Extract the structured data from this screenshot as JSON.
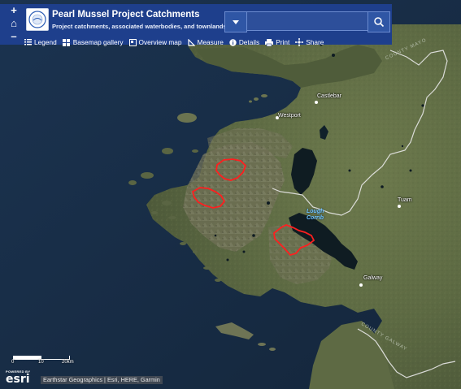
{
  "app": {
    "title": "Pearl Mussel Project Catchments",
    "subtitle": "Project catchments, associated waterbodies, and townlands"
  },
  "zoom": {
    "in_label": "+",
    "home_label": "⌂",
    "out_label": "–"
  },
  "search": {
    "placeholder": "",
    "value": ""
  },
  "toolbar": {
    "legend": "Legend",
    "basemap": "Basemap gallery",
    "overview": "Overview map",
    "measure": "Measure",
    "details": "Details",
    "print": "Print",
    "share": "Share"
  },
  "places": {
    "castlebar": "Castlebar",
    "westport": "Westport",
    "tuam": "Tuam",
    "galway": "Galway",
    "lough_corrib": "Lough\nCorrib",
    "county_mayo": "COUNTY MAYO",
    "county_galway": "COUNTY GALWAY"
  },
  "scale": {
    "label_0": "0",
    "label_10": "10",
    "label_20": "20km"
  },
  "attribution": {
    "powered_by": "POWERED BY",
    "esri": "esri",
    "text": "Earthstar Geographics | Esri, HERE, Garmin"
  },
  "colors": {
    "header": "#1e3f8c",
    "catchment_outline": "#ff1f1f",
    "sea": "#172b41",
    "land": "#5b6a3f"
  }
}
